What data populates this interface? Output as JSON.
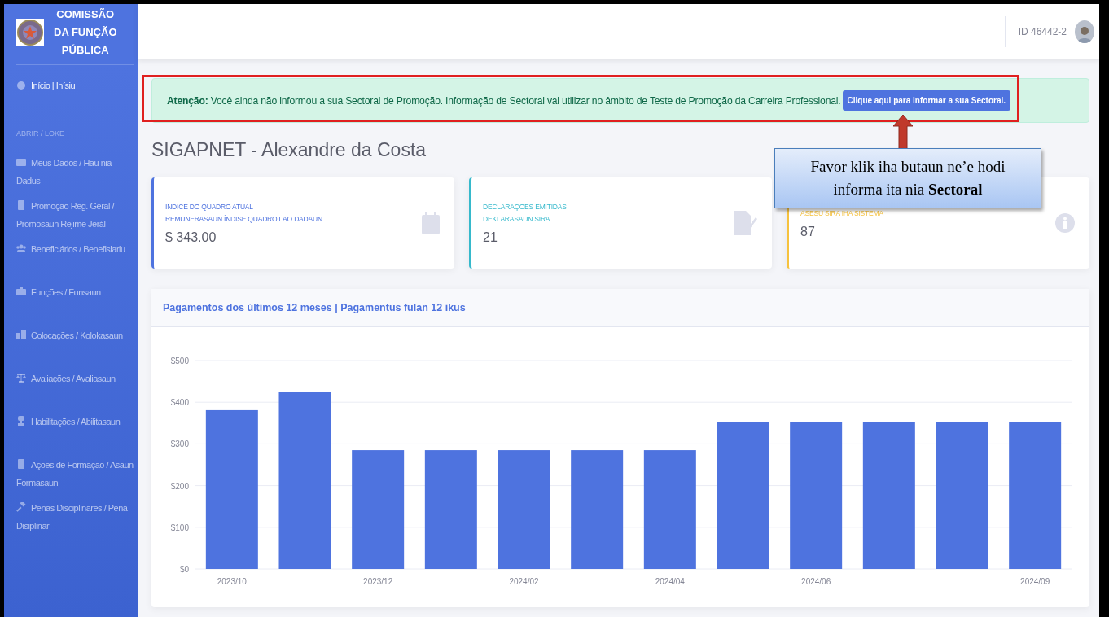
{
  "sidebar": {
    "brand": [
      "COMISSÃO",
      "DA FUNÇÃO",
      "PÚBLICA"
    ],
    "items": [
      {
        "label": "Início | Inísiu",
        "kind": "home"
      },
      {
        "label": "ABRIR / LOKE",
        "kind": "heading"
      },
      {
        "label": "Meus Dados / Hau nia Dadus",
        "kind": "card"
      },
      {
        "label": "Promoção Reg. Geral / Promosaun Rejime Jerál",
        "kind": "doc"
      },
      {
        "label": "Beneficiários / Benefisiariu",
        "kind": "users"
      },
      {
        "label": "Funções / Funsaun",
        "kind": "briefcase"
      },
      {
        "label": "Colocações / Kolokasaun",
        "kind": "building"
      },
      {
        "label": "Avaliações / Avaliasaun",
        "kind": "scale"
      },
      {
        "label": "Habilitações / Abilitasaun",
        "kind": "award"
      },
      {
        "label": "Ações de Formação / Asaun Formasaun",
        "kind": "book"
      },
      {
        "label": "Penas Disciplinares / Pena Disiplinar",
        "kind": "gavel"
      }
    ]
  },
  "topbar": {
    "user_id": "ID 46442-2"
  },
  "alert": {
    "text": "**Atenção:** Você ainda não informou a sua Sectoral de Promoção. Informação de Sectoral vai utilizar no âmbito de Teste de Promoção da Carreira Professional.",
    "button": "Clique aqui para informar a sua Sectoral."
  },
  "callout": {
    "text": "Favor klik iha butaun ne’e hodi informa ita nia **Sectoral**"
  },
  "page_title": "SIGAPNET - Alexandre da Costa",
  "cards": [
    {
      "lines": [
        "ÍNDICE DO QUADRO ATUAL",
        "REMUNERASAUN ÍNDISE QUADRO LAO DADAUN"
      ],
      "value": "$ 343.00",
      "color": "#4e73df",
      "kind": "calendar"
    },
    {
      "lines": [
        "DECLARAÇÕES EMITIDAS",
        "DEKLARASAUN SIRA"
      ],
      "value": "21",
      "color": "#36b9cc",
      "kind": "signature"
    },
    {
      "lines": [
        "ASESU SIRA IHA SISTEMA"
      ],
      "value": "87",
      "color": "#f6c23e",
      "kind": "info"
    }
  ],
  "chart": {
    "title": "Pagamentos dos últimos 12 meses | Pagamentus fulan 12 ikus",
    "chart_data": {
      "type": "bar",
      "categories": [
        "2023/10",
        null,
        "2023/12",
        null,
        "2024/02",
        null,
        "2024/04",
        null,
        "2024/06",
        null,
        null,
        "2024/09"
      ],
      "series": [
        {
          "color": "#4e73df",
          "values": [
            381,
            424,
            285,
            285,
            285,
            285,
            285,
            352,
            352,
            352,
            352,
            352
          ]
        }
      ],
      "ylim": [
        0,
        500
      ],
      "grid": true,
      "yticks": [
        {
          "value": 0,
          "label": "$0"
        },
        {
          "value": 100,
          "label": "$100"
        },
        {
          "value": 200,
          "label": "$200"
        },
        {
          "value": 300,
          "label": "$300"
        },
        {
          "value": 400,
          "label": "$400"
        },
        {
          "value": 500,
          "label": "$500"
        }
      ]
    }
  }
}
